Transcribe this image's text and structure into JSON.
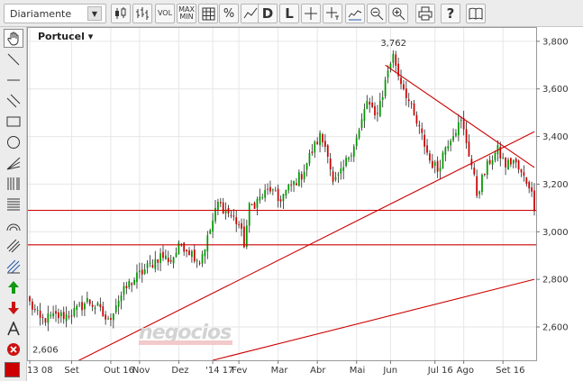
{
  "toolbar": {
    "period": "Diariamente",
    "vol_label": "VOL",
    "maxmin_line1": "MAX",
    "maxmin_line2": "MIN",
    "percent_label": "%",
    "daily_label": "D",
    "line_label": "L"
  },
  "instrument": {
    "name": "Portucel ▾"
  },
  "watermark": "negocios",
  "colors": {
    "up": "#009900",
    "down": "#cc0000",
    "trend": "#cc0000",
    "toolbar": "#ececec",
    "grid": "#e6e6e6"
  },
  "chart_data": {
    "type": "candlestick",
    "title": "Portucel",
    "xlabel": "",
    "ylabel": "",
    "ylim": [
      2.46,
      3.86
    ],
    "y_ticks": [
      2.6,
      2.8,
      3.0,
      3.2,
      3.4,
      3.6,
      3.8
    ],
    "y_tick_labels": [
      "2,600",
      "2,800",
      "3,000",
      "3,200",
      "3,400",
      "3,600",
      "3,800"
    ],
    "x_labels": [
      {
        "label": "13 08",
        "i": 0
      },
      {
        "label": "Set",
        "i": 16
      },
      {
        "label": "Out 16",
        "i": 31
      },
      {
        "label": "Nov",
        "i": 42
      },
      {
        "label": "Dez",
        "i": 57
      },
      {
        "label": "'14 17",
        "i": 70
      },
      {
        "label": "Fev",
        "i": 80
      },
      {
        "label": "Mar",
        "i": 95
      },
      {
        "label": "Abr",
        "i": 110
      },
      {
        "label": "Mai",
        "i": 125
      },
      {
        "label": "Jun",
        "i": 138
      },
      {
        "label": "Jul 16",
        "i": 155
      },
      {
        "label": "Ago",
        "i": 166
      },
      {
        "label": "Set 16",
        "i": 181
      }
    ],
    "n_bars": 194,
    "high_label": {
      "text": "3,762",
      "value": 3.762,
      "i": 139
    },
    "low_label": {
      "text": "2,606",
      "value": 2.606,
      "i": 4
    },
    "anchors": [
      [
        0,
        2.7
      ],
      [
        4,
        2.63
      ],
      [
        8,
        2.64
      ],
      [
        14,
        2.65
      ],
      [
        18,
        2.67
      ],
      [
        22,
        2.71
      ],
      [
        26,
        2.68
      ],
      [
        30,
        2.62
      ],
      [
        33,
        2.7
      ],
      [
        38,
        2.78
      ],
      [
        44,
        2.84
      ],
      [
        50,
        2.9
      ],
      [
        54,
        2.88
      ],
      [
        58,
        2.95
      ],
      [
        62,
        2.91
      ],
      [
        65,
        2.88
      ],
      [
        68,
        2.97
      ],
      [
        72,
        3.12
      ],
      [
        76,
        3.08
      ],
      [
        80,
        3.03
      ],
      [
        82,
        2.95
      ],
      [
        84,
        3.1
      ],
      [
        88,
        3.14
      ],
      [
        92,
        3.18
      ],
      [
        95,
        3.13
      ],
      [
        99,
        3.18
      ],
      [
        104,
        3.24
      ],
      [
        108,
        3.34
      ],
      [
        111,
        3.4
      ],
      [
        114,
        3.34
      ],
      [
        116,
        3.2
      ],
      [
        119,
        3.24
      ],
      [
        122,
        3.32
      ],
      [
        126,
        3.42
      ],
      [
        129,
        3.55
      ],
      [
        132,
        3.48
      ],
      [
        135,
        3.58
      ],
      [
        137,
        3.68
      ],
      [
        139,
        3.75
      ],
      [
        141,
        3.66
      ],
      [
        144,
        3.58
      ],
      [
        147,
        3.48
      ],
      [
        150,
        3.4
      ],
      [
        153,
        3.3
      ],
      [
        156,
        3.26
      ],
      [
        159,
        3.36
      ],
      [
        162,
        3.42
      ],
      [
        165,
        3.46
      ],
      [
        167,
        3.38
      ],
      [
        169,
        3.28
      ],
      [
        171,
        3.16
      ],
      [
        173,
        3.22
      ],
      [
        176,
        3.3
      ],
      [
        179,
        3.34
      ],
      [
        182,
        3.28
      ],
      [
        185,
        3.3
      ],
      [
        188,
        3.24
      ],
      [
        191,
        3.2
      ],
      [
        193,
        3.11
      ]
    ],
    "horizontal_lines": [
      3.09,
      2.945
    ],
    "trend_lines": [
      {
        "from": [
          18,
          2.455
        ],
        "to": [
          193,
          3.42
        ]
      },
      {
        "from": [
          136,
          3.7
        ],
        "to": [
          193,
          3.27
        ]
      },
      {
        "from": [
          70,
          2.46
        ],
        "to": [
          193,
          2.8
        ]
      }
    ]
  }
}
